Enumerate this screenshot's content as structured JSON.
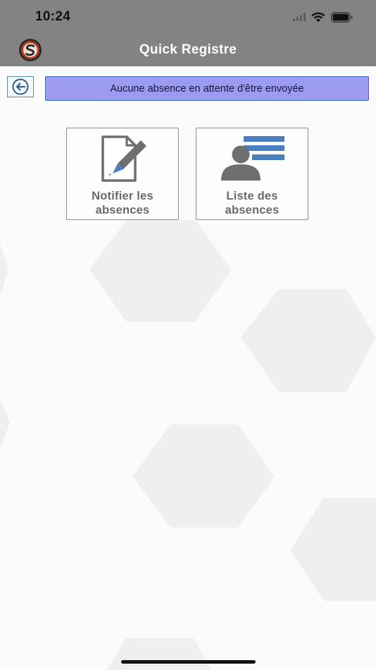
{
  "status_bar": {
    "time": "10:24"
  },
  "header": {
    "title": "Quick Registre"
  },
  "banner": {
    "text": "Aucune absence en attente d'être envoyée"
  },
  "tiles": [
    {
      "label_line1": "Notifier les",
      "label_line2": "absences",
      "icon": "edit-document-icon"
    },
    {
      "label_line1": "Liste des",
      "label_line2": "absences",
      "icon": "person-list-icon"
    }
  ],
  "colors": {
    "header_bg": "#838383",
    "banner_bg": "#9b9bf2",
    "accent_blue": "#4a7fbf",
    "tile_text": "#6b6b6b"
  }
}
